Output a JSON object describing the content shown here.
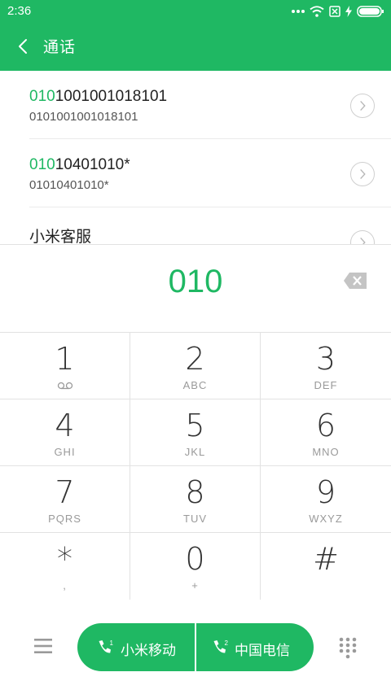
{
  "status_bar": {
    "time": "2:36"
  },
  "header": {
    "title": "通话"
  },
  "results": [
    {
      "primary_highlight": "010",
      "primary_rest": "1001001018101",
      "secondary": "0101001001018101"
    },
    {
      "primary_highlight": "010",
      "primary_rest": "10401010*",
      "secondary": "01010401010*"
    },
    {
      "primary_highlight": "",
      "primary_rest": "小米客服",
      "secondary": ""
    }
  ],
  "dialer": {
    "number": "010"
  },
  "keypad": [
    {
      "digit": "1",
      "sub": ""
    },
    {
      "digit": "2",
      "sub": "ABC"
    },
    {
      "digit": "3",
      "sub": "DEF"
    },
    {
      "digit": "4",
      "sub": "GHI"
    },
    {
      "digit": "5",
      "sub": "JKL"
    },
    {
      "digit": "6",
      "sub": "MNO"
    },
    {
      "digit": "7",
      "sub": "PQRS"
    },
    {
      "digit": "8",
      "sub": "TUV"
    },
    {
      "digit": "9",
      "sub": "WXYZ"
    },
    {
      "digit": "*",
      "sub": ","
    },
    {
      "digit": "0",
      "sub": "+"
    },
    {
      "digit": "#",
      "sub": ""
    }
  ],
  "call_buttons": {
    "sim1": {
      "label": "小米移动",
      "badge": "1"
    },
    "sim2": {
      "label": "中国电信",
      "badge": "2"
    }
  },
  "colors": {
    "accent": "#1fb863",
    "text": "#222222",
    "muted": "#9a9a9a",
    "divider": "#e2e2e2"
  },
  "icons": [
    "wifi-icon",
    "no-sim-icon",
    "charging-icon",
    "battery-icon",
    "back-icon",
    "chevron-right-icon",
    "backspace-icon",
    "voicemail-icon",
    "menu-icon",
    "phone-icon",
    "dialpad-icon"
  ]
}
